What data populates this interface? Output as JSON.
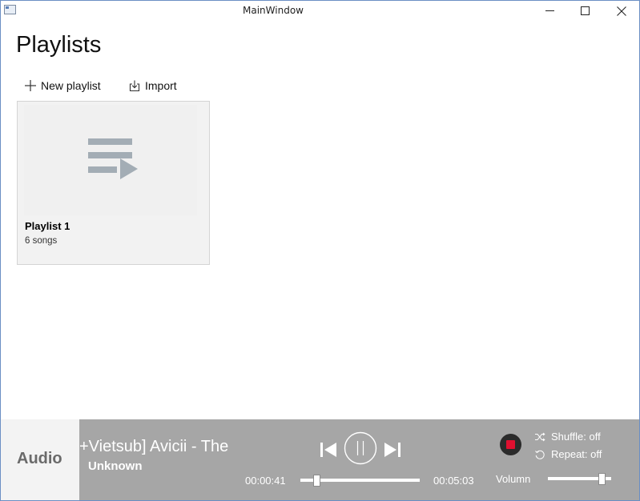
{
  "window": {
    "title": "MainWindow",
    "controls": {
      "minimize_icon": "minimize-icon",
      "maximize_icon": "maximize-icon",
      "close_icon": "close-icon"
    }
  },
  "page": {
    "title": "Playlists",
    "commands": [
      {
        "label": "New playlist",
        "icon": "plus-icon"
      },
      {
        "label": "Import",
        "icon": "import-icon"
      }
    ]
  },
  "playlists": [
    {
      "name": "Playlist 1",
      "count": "6 songs",
      "icon": "playlist-icon"
    }
  ],
  "player": {
    "section_label": "Audio",
    "track_title": "+Vietsub] Avicii - The",
    "artist": "Unknown",
    "current_time": "00:00:41",
    "total_time": "00:05:03",
    "seek_progress": 0.135,
    "controls": {
      "previous_icon": "skip-previous-icon",
      "pause_icon": "pause-icon",
      "next_icon": "skip-next-icon",
      "record_icon": "stop-record-icon"
    },
    "shuffle_label": "Shuffle: off",
    "repeat_label": "Repeat: off",
    "volume_label": "Volumn",
    "volume_level": 0.85,
    "colors": {
      "bar_bg": "#a6a6a6",
      "left_bg": "#f3f3f3",
      "record": "#e01030"
    }
  }
}
